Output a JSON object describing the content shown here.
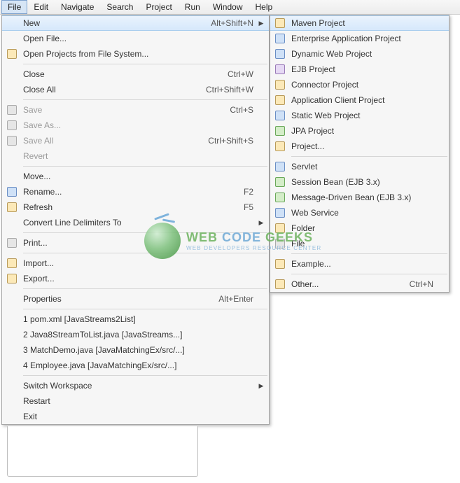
{
  "menubar": [
    "File",
    "Edit",
    "Navigate",
    "Search",
    "Project",
    "Run",
    "Window",
    "Help"
  ],
  "file_menu": {
    "new": {
      "label": "New",
      "accel": "Alt+Shift+N",
      "arrow": true,
      "hl": true
    },
    "open": {
      "label": "Open File..."
    },
    "open_projects": {
      "label": "Open Projects from File System..."
    },
    "close": {
      "label": "Close",
      "accel": "Ctrl+W"
    },
    "close_all": {
      "label": "Close All",
      "accel": "Ctrl+Shift+W"
    },
    "save": {
      "label": "Save",
      "accel": "Ctrl+S",
      "disabled": true
    },
    "save_as": {
      "label": "Save As...",
      "disabled": true
    },
    "save_all": {
      "label": "Save All",
      "accel": "Ctrl+Shift+S",
      "disabled": true
    },
    "revert": {
      "label": "Revert",
      "disabled": true
    },
    "move": {
      "label": "Move..."
    },
    "rename": {
      "label": "Rename...",
      "accel": "F2"
    },
    "refresh": {
      "label": "Refresh",
      "accel": "F5"
    },
    "convert": {
      "label": "Convert Line Delimiters To",
      "arrow": true
    },
    "print": {
      "label": "Print..."
    },
    "import": {
      "label": "Import..."
    },
    "export": {
      "label": "Export..."
    },
    "properties": {
      "label": "Properties",
      "accel": "Alt+Enter"
    },
    "rec1": {
      "label": "1 pom.xml  [JavaStreams2List]"
    },
    "rec2": {
      "label": "2 Java8StreamToList.java  [JavaStreams...]"
    },
    "rec3": {
      "label": "3 MatchDemo.java  [JavaMatchingEx/src/...]"
    },
    "rec4": {
      "label": "4 Employee.java  [JavaMatchingEx/src/...]"
    },
    "switch_ws": {
      "label": "Switch Workspace",
      "arrow": true
    },
    "restart": {
      "label": "Restart"
    },
    "exit": {
      "label": "Exit"
    }
  },
  "new_submenu": [
    {
      "key": "maven",
      "label": "Maven Project",
      "hl": true
    },
    {
      "key": "enterprise",
      "label": "Enterprise Application Project"
    },
    {
      "key": "dynweb",
      "label": "Dynamic Web Project"
    },
    {
      "key": "ejb",
      "label": "EJB Project"
    },
    {
      "key": "connector",
      "label": "Connector Project"
    },
    {
      "key": "appclient",
      "label": "Application Client Project"
    },
    {
      "key": "staticweb",
      "label": "Static Web Project"
    },
    {
      "key": "jpa",
      "label": "JPA Project"
    },
    {
      "key": "project",
      "label": "Project..."
    },
    {
      "sep": true
    },
    {
      "key": "servlet",
      "label": "Servlet"
    },
    {
      "key": "session",
      "label": "Session Bean (EJB 3.x)"
    },
    {
      "key": "mdb",
      "label": "Message-Driven Bean (EJB 3.x)"
    },
    {
      "key": "websvc",
      "label": "Web Service"
    },
    {
      "key": "folder",
      "label": "Folder"
    },
    {
      "key": "file",
      "label": "File"
    },
    {
      "sep": true
    },
    {
      "key": "example",
      "label": "Example..."
    },
    {
      "sep": true
    },
    {
      "key": "other",
      "label": "Other...",
      "accel": "Ctrl+N"
    }
  ],
  "watermark": {
    "main": "WEB CODE GEEKS",
    "sub": "WEB DEVELOPERS RESOURCE CENTER"
  }
}
